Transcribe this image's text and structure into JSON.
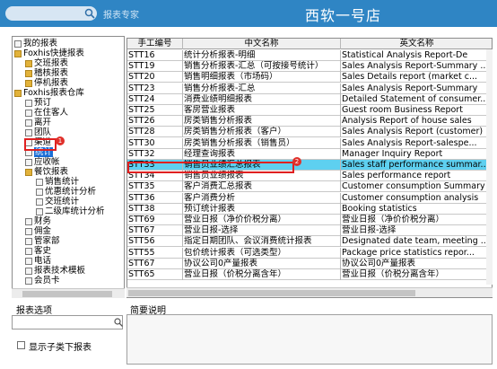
{
  "header": {
    "search_label": "报表专家",
    "app_title": "西软一号店"
  },
  "tree": {
    "items": [
      {
        "label": "我的报表",
        "icon": "folder-icon"
      },
      {
        "label": "Foxhis快捷报表",
        "icon": "folder-icon"
      },
      {
        "label": "交班报表",
        "icon": "folder-icon"
      },
      {
        "label": "稽核报表",
        "icon": "folder-icon"
      },
      {
        "label": "停机报表",
        "icon": "folder-icon"
      },
      {
        "label": "Foxhis报表仓库",
        "icon": "folder-icon"
      },
      {
        "label": "预订",
        "icon": "page-icon"
      },
      {
        "label": "在住客人",
        "icon": "page-icon"
      },
      {
        "label": "离开",
        "icon": "page-icon"
      },
      {
        "label": "团队",
        "icon": "page-icon"
      },
      {
        "label": "渠道",
        "icon": "page-icon"
      },
      {
        "label": "统计",
        "icon": "page-icon"
      },
      {
        "label": "应收帐",
        "icon": "page-icon"
      },
      {
        "label": "餐饮报表",
        "icon": "folder-icon"
      },
      {
        "label": "销售统计",
        "icon": "page-icon"
      },
      {
        "label": "优惠统计分析",
        "icon": "page-icon"
      },
      {
        "label": "交班统计",
        "icon": "page-icon"
      },
      {
        "label": "二级库统计分析",
        "icon": "page-icon"
      },
      {
        "label": "财务",
        "icon": "page-icon"
      },
      {
        "label": "佣金",
        "icon": "page-icon"
      },
      {
        "label": "管家部",
        "icon": "page-icon"
      },
      {
        "label": "客史",
        "icon": "page-icon"
      },
      {
        "label": "电话",
        "icon": "page-icon"
      },
      {
        "label": "报表技术模板",
        "icon": "page-icon"
      },
      {
        "label": "会员卡",
        "icon": "page-icon"
      }
    ],
    "selected_label": "统计",
    "badge1": "1"
  },
  "table": {
    "columns": [
      "手工编号",
      "中文名称",
      "英文名称"
    ],
    "rows": [
      {
        "code": "STT16",
        "cn": "统计分析报表-明细",
        "en": "Statistical Analysis Report-De"
      },
      {
        "code": "STT19",
        "cn": "销售分析报表-汇总（可按接号统计）",
        "en": "Sales Analysis Report-Summary ..."
      },
      {
        "code": "STT20",
        "cn": "销售明细报表（市场码）",
        "en": "Sales Details report (market c..."
      },
      {
        "code": "STT23",
        "cn": "销售分析报表-汇总",
        "en": "Sales Analysis Report-Summary"
      },
      {
        "code": "STT24",
        "cn": "消费业绩明细报表",
        "en": "Detailed Statement of consumer..."
      },
      {
        "code": "STT25",
        "cn": "客房营业报表",
        "en": "Guest room Business Report"
      },
      {
        "code": "STT26",
        "cn": "房类销售分析报表",
        "en": "Analysis Report of house sales"
      },
      {
        "code": "STT28",
        "cn": "房类销售分析报表（客户）",
        "en": "Sales Analysis Report (customer)"
      },
      {
        "code": "STT30",
        "cn": "房类销售分析报表（销售员）",
        "en": "Sales Analysis Report-salespe..."
      },
      {
        "code": "STT32",
        "cn": "经理查询报表",
        "en": "Manager Inquiry Report"
      },
      {
        "code": "STT33",
        "cn": "销售员业绩汇总报表",
        "en": "Sales staff performance summar..."
      },
      {
        "code": "STT34",
        "cn": "销售员业绩报表",
        "en": "Sales performance report"
      },
      {
        "code": "STT35",
        "cn": "客户消费汇总报表",
        "en": "Customer consumption Summary R..."
      },
      {
        "code": "STT36",
        "cn": "客户消费分析",
        "en": "Customer consumption analysis"
      },
      {
        "code": "STT38",
        "cn": "预订统计报表",
        "en": "Booking statistics"
      },
      {
        "code": "STT69",
        "cn": "营业日报（净价价税分离）",
        "en": "营业日报（净价价税分离）"
      },
      {
        "code": "STT67",
        "cn": "营业日报-选择",
        "en": "营业日报-选择"
      },
      {
        "code": "STT56",
        "cn": "指定日期团队、会议消费统计报表",
        "en": "Designated date team, meeting ..."
      },
      {
        "code": "STT55",
        "cn": "包价统计报表（可选类型）",
        "en": "Package price statistics repor..."
      },
      {
        "code": "STT67",
        "cn": "协议公司0产量报表",
        "en": "协议公司0产量报表"
      },
      {
        "code": "STT65",
        "cn": "营业日报（价税分离含年）",
        "en": "营业日报（价税分离含年）"
      }
    ],
    "highlighted_code": "STT33",
    "badge2": "2"
  },
  "bottom": {
    "options_title": "报表选项",
    "checkbox_label": "显示子类下报表",
    "checkbox_checked": false,
    "desc_title": "简要说明"
  },
  "colors": {
    "header_bg": "#2f85c4",
    "highlight_row": "#5ed0f0",
    "annotation_red": "#e02020"
  }
}
